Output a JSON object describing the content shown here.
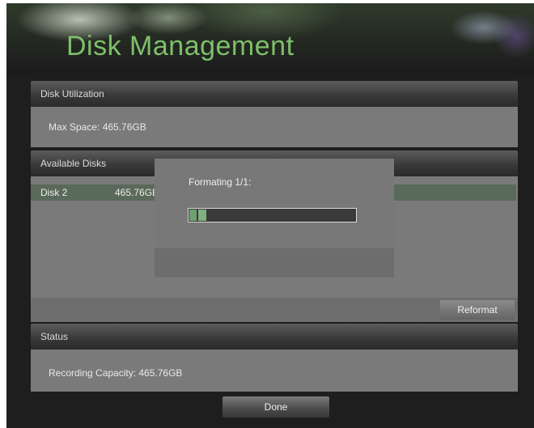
{
  "top_fragment": "‾‾‾‾‾‾‾",
  "title": "Disk Management",
  "disk_utilization": {
    "header": "Disk Utilization",
    "max_space": "Max Space: 465.76GB"
  },
  "available_disks": {
    "header": "Available Disks",
    "rows": [
      {
        "name": "Disk 2",
        "size": "465.76GB"
      }
    ],
    "reformat_label": "Reformat"
  },
  "status": {
    "header": "Status",
    "recording_capacity": "Recording Capacity: 465.76GB"
  },
  "done_label": "Done",
  "dialog": {
    "message": "Formating 1/1:",
    "progress_percent": 10
  },
  "colors": {
    "title": "#7fbf6a",
    "progress_fill": "#6f9f6f",
    "selected_row": "#5a6a5a"
  }
}
